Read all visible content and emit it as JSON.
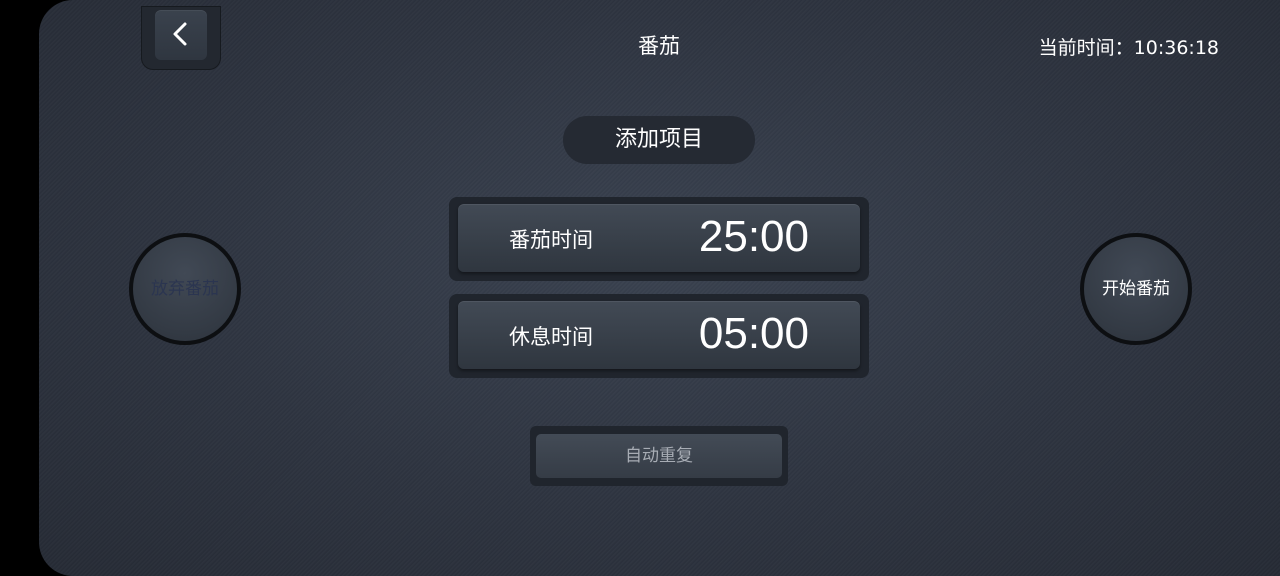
{
  "header": {
    "title": "番茄",
    "clock_text": "当前时间：10:36:18",
    "back_icon": "chevron-left-icon"
  },
  "main": {
    "add_item_label": "添加项目",
    "pomodoro": {
      "label": "番茄时间",
      "value": "25:00"
    },
    "break": {
      "label": "休息时间",
      "value": "05:00"
    },
    "auto_repeat_label": "自动重复"
  },
  "controls": {
    "abandon_label": "放弃番茄",
    "start_label": "开始番茄"
  },
  "colors": {
    "background": "#2e3440",
    "abandon_text": "#2b3550",
    "text": "#ffffff",
    "auto_repeat_text": "#a7acb4"
  }
}
